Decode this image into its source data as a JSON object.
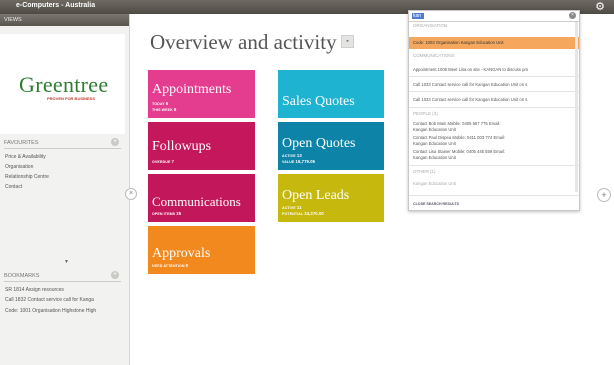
{
  "app": {
    "title": "e-Computers - Australia"
  },
  "left_panel": {
    "header": "VIEWS",
    "logo_text": "Greentree",
    "logo_tagline": "PROVEN FOR BUSINESS",
    "favourites": {
      "header": "FAVOURITES",
      "items": [
        "Price & Availability",
        "Organisation",
        "Relationship Centre",
        "Contact"
      ]
    },
    "bookmarks": {
      "header": "BOOKMARKS",
      "items": [
        "SR 1814 Assign resources",
        "Call 1832 Contact service call for Kanga",
        "Code: 1001 Organisation Highstone High"
      ]
    }
  },
  "main": {
    "title": "Overview and activity",
    "tiles": [
      {
        "title": "Appointments",
        "meta": [
          [
            "TODAY",
            "6"
          ],
          [
            "THIS WEEK",
            "8"
          ]
        ],
        "color": "#e43d8f"
      },
      {
        "title": "Followups",
        "meta": [
          [
            "OVERDUE",
            "7"
          ]
        ],
        "color": "#c4175c"
      },
      {
        "title": "Communications",
        "meta": [
          [
            "OPEN ITEMS",
            "35"
          ]
        ],
        "color": "#c2185b"
      },
      {
        "title": "Approvals",
        "meta": [
          [
            "NEED ATTENTION",
            "0"
          ]
        ],
        "color": "#f2891f"
      },
      {
        "title": "Sales Quotes",
        "meta": [],
        "color": "#1fb3d2"
      },
      {
        "title": "Open Quotes",
        "meta": [
          [
            "ACTIVE",
            "13"
          ],
          [
            "VALUE",
            "16,779.05"
          ]
        ],
        "color": "#0d84a7"
      },
      {
        "title": "Open Leads",
        "meta": [
          [
            "ACTIVE",
            "11"
          ],
          [
            "POTENTIAL",
            "24,370.00"
          ]
        ],
        "color": "#c7b80e"
      }
    ]
  },
  "search": {
    "query": "kan",
    "sections": [
      {
        "label": "ORGANISATION",
        "items": [
          "Code: 1003 Organisation Kangan Education Unit"
        ]
      },
      {
        "label": "COMMUNICATIONS",
        "items": [
          "Appointment 1006 Meet Lisa on site - KANGAN to discuss pro",
          "Call 1033 Contact service call for Kangan Education Unit on s",
          "Call 1033 Contact service call for Kangan Education Unit on s"
        ]
      },
      {
        "label": "PEOPLE (3)",
        "items": [
          "Contact Bob Main Mobile: 0405 567 775 Email:",
          "Kangan Education Unit",
          "Contact Paul Dispea Mobile: 0411 003 774 Email:",
          "Kangan Education Unit",
          "Contact Lisa Stainer Mobile: 0405 445 559 Email:",
          "Kangan Education Unit"
        ]
      },
      {
        "label": "OTHER (1)",
        "items": [
          "Kangan Education Unit"
        ]
      }
    ],
    "footer": "CLOSE SEARCH RESULTS"
  }
}
